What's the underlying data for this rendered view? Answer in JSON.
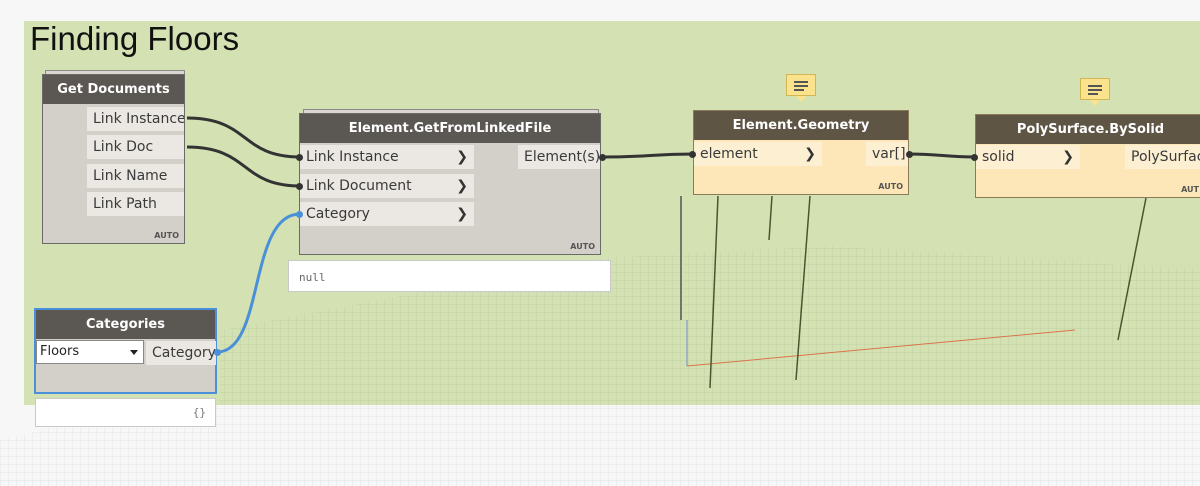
{
  "workspace": {
    "group_title": "Finding Floors"
  },
  "nodes": {
    "get_documents": {
      "title": "Get Documents",
      "outputs": [
        "Link Instance",
        "Link Doc",
        "Link Name",
        "Link Path"
      ],
      "lacing": "AUTO"
    },
    "element_get_from_linked_file": {
      "title": "Element.GetFromLinkedFile",
      "inputs": [
        "Link Instance",
        "Link Document",
        "Category"
      ],
      "output": "Element(s)",
      "lacing": "AUTO",
      "preview": "null"
    },
    "element_geometry": {
      "title": "Element.Geometry",
      "input": "element",
      "output": "var[]",
      "lacing": "AUTO"
    },
    "polysurface_by_solid": {
      "title": "PolySurface.BySolid",
      "input": "solid",
      "output": "PolySurfac",
      "lacing": "AUT"
    },
    "categories": {
      "title": "Categories",
      "selected": "Floors",
      "output": "Category",
      "preview": "{}"
    }
  },
  "colors": {
    "group_background": "#cbdda0",
    "node_header": "#5b5752",
    "selected_border": "#4a90d9",
    "wire": "#333333",
    "category_wire": "#4a90d9",
    "note": "#fbe38d"
  }
}
